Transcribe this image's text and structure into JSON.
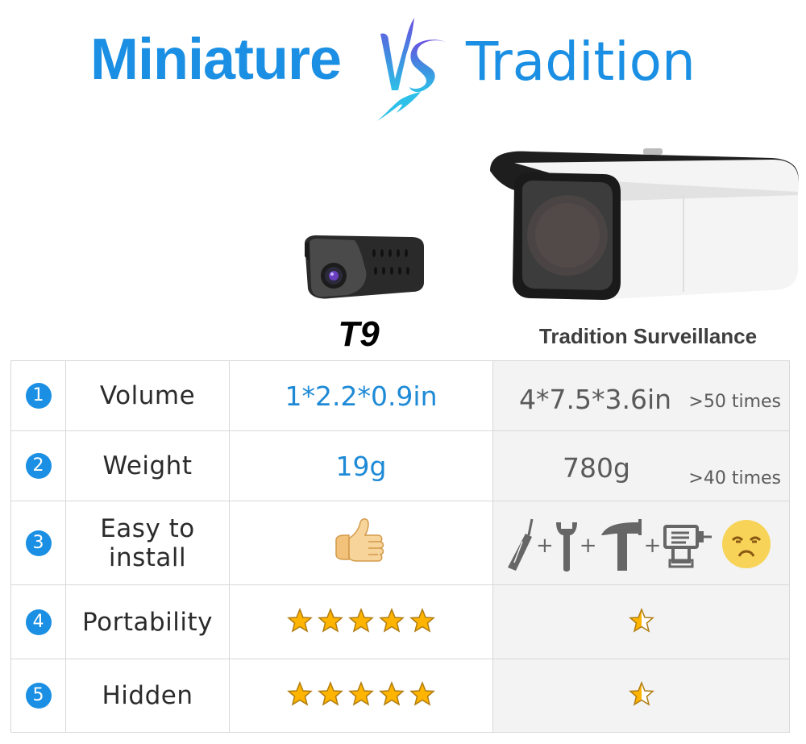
{
  "title": {
    "left": "Miniature",
    "vs": "VS",
    "right": "Tradition"
  },
  "products": {
    "miniature": {
      "name": "T9",
      "image": "mini-camera"
    },
    "tradition": {
      "name": "Tradition Surveillance",
      "image": "bullet-camera"
    }
  },
  "colors": {
    "accent_blue": "#1a8fe3",
    "value_blue": "#1e8ad6",
    "tradition_gray": "#5a5a5a",
    "star_gold": "#ffb400",
    "tradition_bg": "#f3f3f3"
  },
  "rows": [
    {
      "num": "1",
      "label": "Volume",
      "t9": "1*2.2*0.9in",
      "tradition": "4*7.5*3.6in",
      "note": ">50 times"
    },
    {
      "num": "2",
      "label": "Weight",
      "t9": "19g",
      "tradition": "780g",
      "note": ">40 times"
    },
    {
      "num": "3",
      "label": "Easy to install",
      "t9_icon": "thumbs-up-icon",
      "tradition_icons": [
        "screwdriver-icon",
        "wrench-icon",
        "hammer-icon",
        "drill-icon"
      ],
      "tradition_plus": "+",
      "tradition_mood": "sad-face-icon"
    },
    {
      "num": "4",
      "label": "Portability",
      "t9_rating": 5,
      "tradition_rating": 0.5,
      "rating_max": 5
    },
    {
      "num": "5",
      "label": "Hidden",
      "t9_rating": 5,
      "tradition_rating": 0.5,
      "rating_max": 5
    }
  ]
}
